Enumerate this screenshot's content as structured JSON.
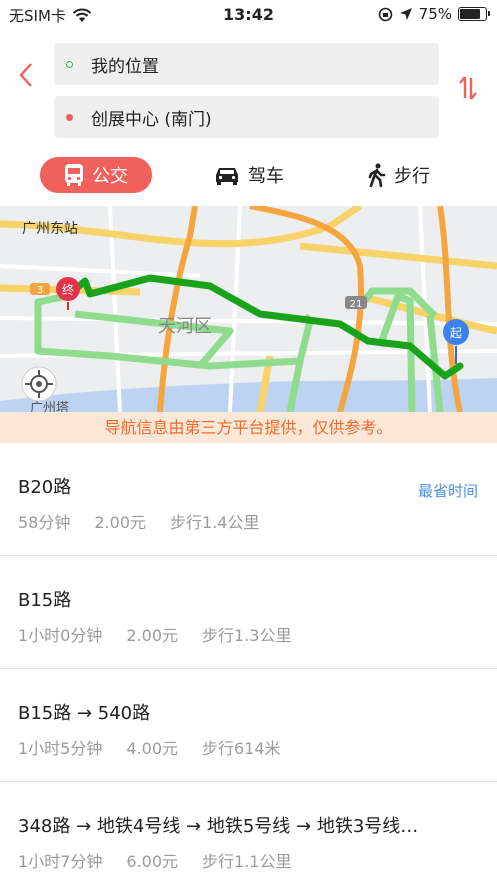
{
  "status": {
    "carrier": "无SIM卡",
    "time": "13:42",
    "battery": "75%"
  },
  "search": {
    "origin": "我的位置",
    "destination": "创展中心 (南门)"
  },
  "modes": [
    {
      "label": "公交",
      "active": true
    },
    {
      "label": "驾车",
      "active": false
    },
    {
      "label": "步行",
      "active": false
    }
  ],
  "map": {
    "labels": {
      "station": "广州东站",
      "district": "天河区",
      "tower": "广州塔",
      "road_3": "3",
      "road_21": "21"
    },
    "markers": {
      "end": "终",
      "start": "起"
    }
  },
  "notice": "导航信息由第三方平台提供，仅供参考。",
  "routes": [
    {
      "title": "B20路",
      "time": "58分钟",
      "price": "2.00元",
      "walk": "步行1.4公里",
      "tag": "最省时间"
    },
    {
      "title": "B15路",
      "time": "1小时0分钟",
      "price": "2.00元",
      "walk": "步行1.3公里",
      "tag": ""
    },
    {
      "title": "B15路 → 540路",
      "time": "1小时5分钟",
      "price": "4.00元",
      "walk": "步行614米",
      "tag": ""
    },
    {
      "title": "348路 → 地铁4号线 → 地铁5号线 → 地铁3号线…",
      "time": "1小时7分钟",
      "price": "6.00元",
      "walk": "步行1.1公里",
      "tag": ""
    }
  ],
  "colors": {
    "accent": "#f0615e",
    "route_dark": "#1aa31a",
    "route_light": "#8fdc8f",
    "notice": "#f2692b",
    "link": "#4a90e2"
  }
}
